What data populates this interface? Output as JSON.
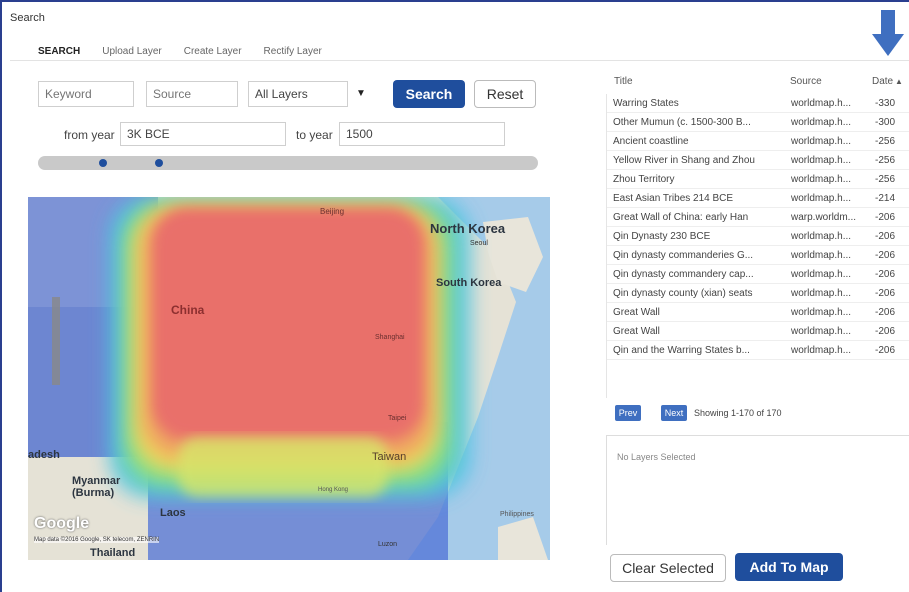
{
  "window": {
    "title": "Search"
  },
  "tabs": [
    {
      "label": "SEARCH"
    },
    {
      "label": "Upload Layer"
    },
    {
      "label": "Create Layer"
    },
    {
      "label": "Rectify Layer"
    }
  ],
  "search_form": {
    "keyword_placeholder": "Keyword",
    "source_placeholder": "Source",
    "layers_selected": "All Layers",
    "search_label": "Search",
    "reset_label": "Reset",
    "from_year_label": "from year",
    "from_year_value": "3K BCE",
    "to_year_label": "to year",
    "to_year_value": "1500"
  },
  "map": {
    "labels": {
      "north_korea": "North Korea",
      "south_korea": "South Korea",
      "china": "China",
      "beijing": "Beijing",
      "seoul": "Seoul",
      "shanghai": "Shanghai",
      "taipei": "Taipei",
      "taiwan": "Taiwan",
      "hong_kong": "Hong Kong",
      "myanmar": "Myanmar\n(Burma)",
      "laos": "Laos",
      "thailand": "Thailand",
      "philippines": "Philippines",
      "luzon": "Luzon",
      "bangladesh": "adesh"
    },
    "attribution": "Map data ©2016 Google, SK telecom, ZENRIN",
    "google_logo": "Google"
  },
  "results": {
    "columns": [
      "Title",
      "Source",
      "Date"
    ],
    "rows": [
      {
        "title": "Warring States",
        "source": "worldmap.h...",
        "date": "-330"
      },
      {
        "title": "Other Mumun (c. 1500-300 B...",
        "source": "worldmap.h...",
        "date": "-300"
      },
      {
        "title": "Ancient coastline",
        "source": "worldmap.h...",
        "date": "-256"
      },
      {
        "title": "Yellow River in Shang and Zhou",
        "source": "worldmap.h...",
        "date": "-256"
      },
      {
        "title": "Zhou Territory",
        "source": "worldmap.h...",
        "date": "-256"
      },
      {
        "title": "East Asian Tribes 214 BCE",
        "source": "worldmap.h...",
        "date": "-214"
      },
      {
        "title": "Great Wall of China: early Han",
        "source": "warp.worldm...",
        "date": "-206"
      },
      {
        "title": "Qin Dynasty 230 BCE",
        "source": "worldmap.h...",
        "date": "-206"
      },
      {
        "title": "Qin dynasty commanderies G...",
        "source": "worldmap.h...",
        "date": "-206"
      },
      {
        "title": "Qin dynasty commandery cap...",
        "source": "worldmap.h...",
        "date": "-206"
      },
      {
        "title": "Qin dynasty county (xian) seats",
        "source": "worldmap.h...",
        "date": "-206"
      },
      {
        "title": "Great Wall",
        "source": "worldmap.h...",
        "date": "-206"
      },
      {
        "title": "Great Wall",
        "source": "worldmap.h...",
        "date": "-206"
      },
      {
        "title": "Qin and the Warring States b...",
        "source": "worldmap.h...",
        "date": "-206"
      }
    ],
    "prev_label": "Prev",
    "next_label": "Next",
    "showing": "Showing 1-170 of 170",
    "no_selection": "No Layers Selected",
    "clear_label": "Clear Selected",
    "add_label": "Add To Map"
  },
  "colors": {
    "accent": "#1f4e9d",
    "arrow": "#3f6fc0"
  }
}
